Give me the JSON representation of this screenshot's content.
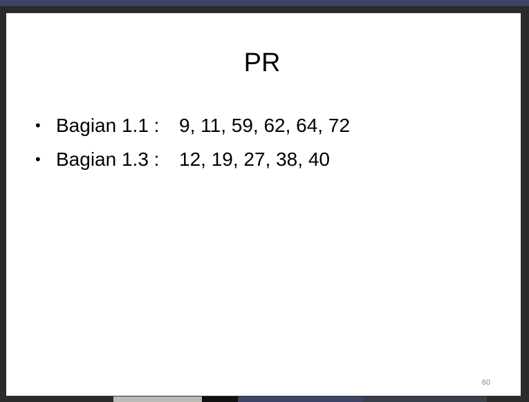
{
  "slide": {
    "title": "PR",
    "bullets": [
      {
        "marker": "•",
        "label": "Bagian 1.1 :",
        "values": "9, 11, 59, 62, 64, 72"
      },
      {
        "marker": "•",
        "label": "Bagian 1.3 :",
        "values": "12, 19, 27, 38, 40"
      }
    ],
    "page_number": "60"
  },
  "colors": {
    "top_bar": "#3e4466",
    "slide_background": "#ffffff",
    "text": "#000000",
    "page_number": "#808080"
  }
}
